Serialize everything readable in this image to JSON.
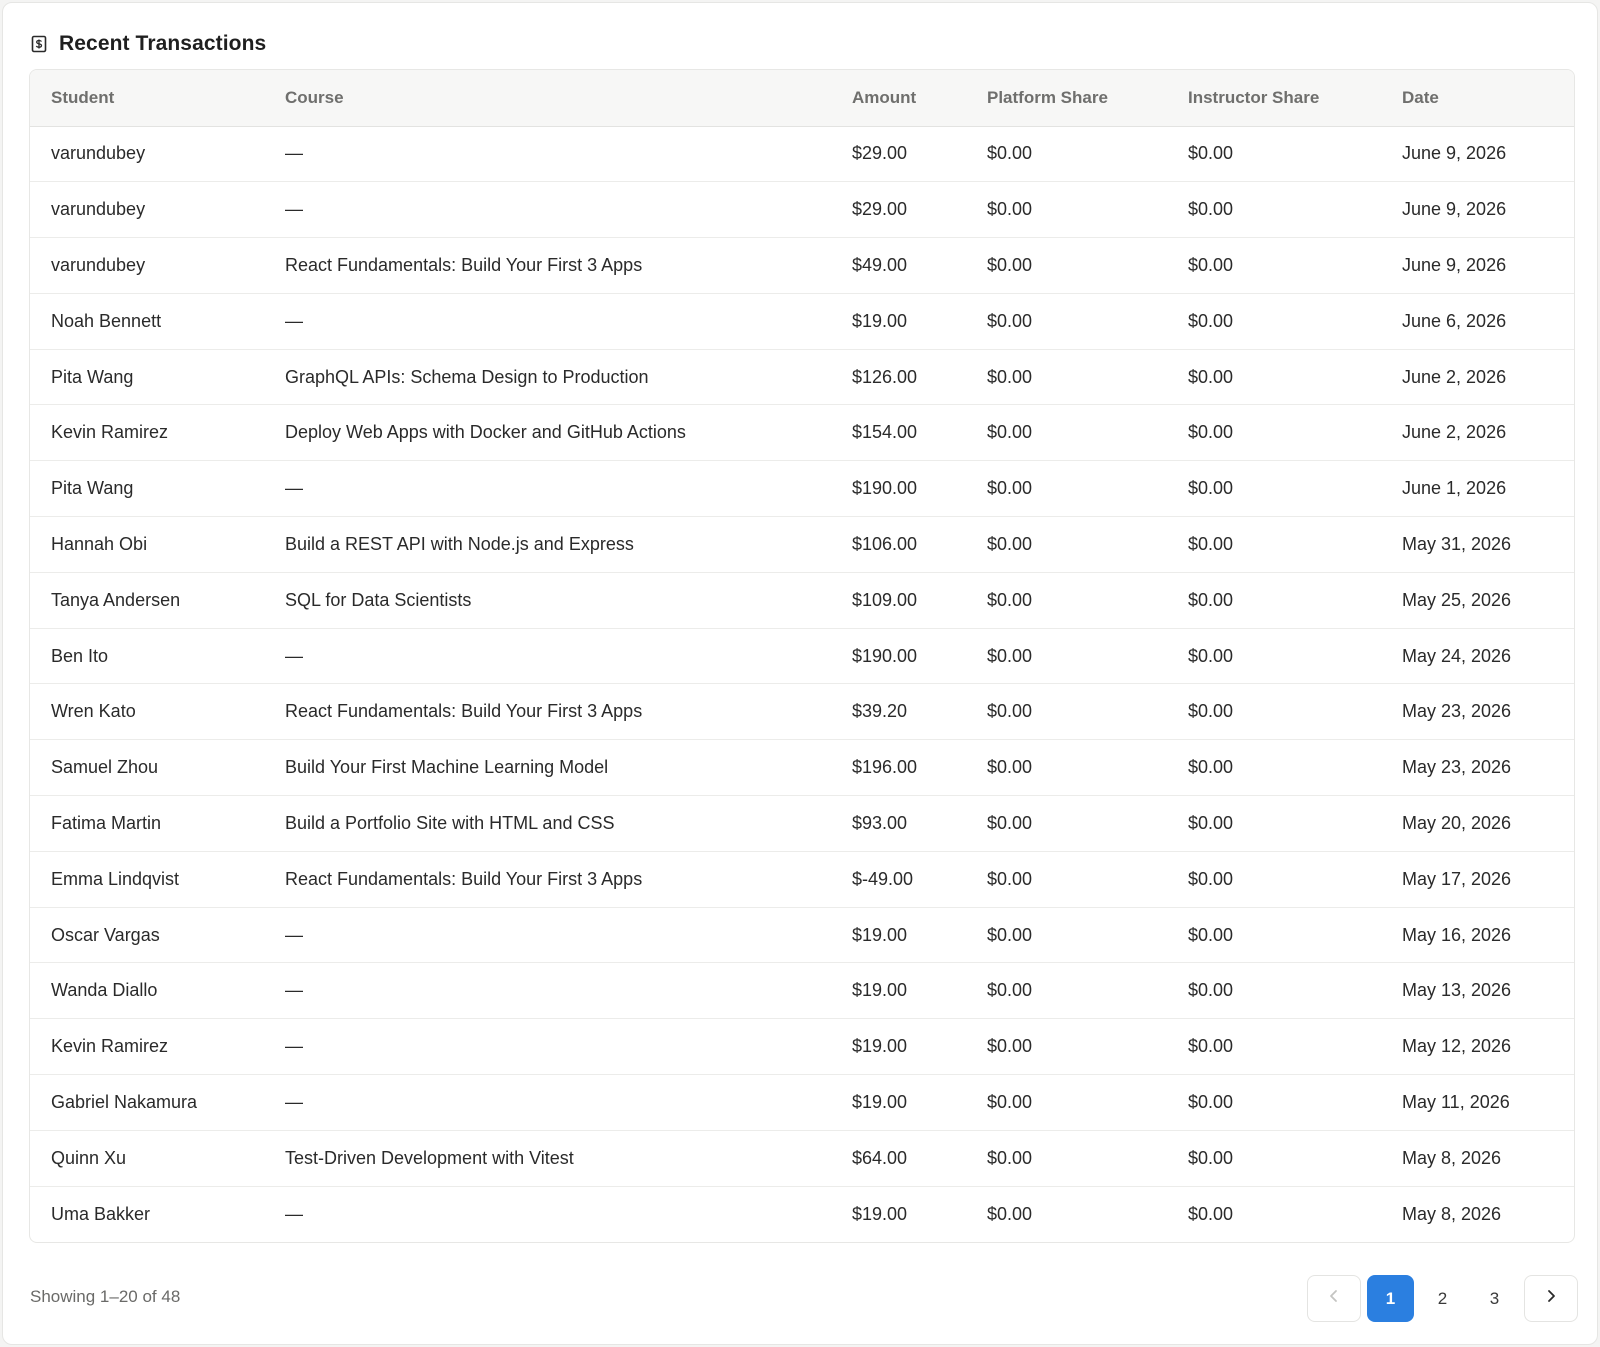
{
  "card": {
    "title": "Recent Transactions",
    "icon": "dollar-receipt-icon"
  },
  "table": {
    "headers": [
      "Student",
      "Course",
      "Amount",
      "Platform Share",
      "Instructor Share",
      "Date"
    ],
    "rows": [
      [
        "varundubey",
        "—",
        "$29.00",
        "$0.00",
        "$0.00",
        "June 9, 2026"
      ],
      [
        "varundubey",
        "—",
        "$29.00",
        "$0.00",
        "$0.00",
        "June 9, 2026"
      ],
      [
        "varundubey",
        "React Fundamentals: Build Your First 3 Apps",
        "$49.00",
        "$0.00",
        "$0.00",
        "June 9, 2026"
      ],
      [
        "Noah Bennett",
        "—",
        "$19.00",
        "$0.00",
        "$0.00",
        "June 6, 2026"
      ],
      [
        "Pita Wang",
        "GraphQL APIs: Schema Design to Production",
        "$126.00",
        "$0.00",
        "$0.00",
        "June 2, 2026"
      ],
      [
        "Kevin Ramirez",
        "Deploy Web Apps with Docker and GitHub Actions",
        "$154.00",
        "$0.00",
        "$0.00",
        "June 2, 2026"
      ],
      [
        "Pita Wang",
        "—",
        "$190.00",
        "$0.00",
        "$0.00",
        "June 1, 2026"
      ],
      [
        "Hannah Obi",
        "Build a REST API with Node.js and Express",
        "$106.00",
        "$0.00",
        "$0.00",
        "May 31, 2026"
      ],
      [
        "Tanya Andersen",
        "SQL for Data Scientists",
        "$109.00",
        "$0.00",
        "$0.00",
        "May 25, 2026"
      ],
      [
        "Ben Ito",
        "—",
        "$190.00",
        "$0.00",
        "$0.00",
        "May 24, 2026"
      ],
      [
        "Wren Kato",
        "React Fundamentals: Build Your First 3 Apps",
        "$39.20",
        "$0.00",
        "$0.00",
        "May 23, 2026"
      ],
      [
        "Samuel Zhou",
        "Build Your First Machine Learning Model",
        "$196.00",
        "$0.00",
        "$0.00",
        "May 23, 2026"
      ],
      [
        "Fatima Martin",
        "Build a Portfolio Site with HTML and CSS",
        "$93.00",
        "$0.00",
        "$0.00",
        "May 20, 2026"
      ],
      [
        "Emma Lindqvist",
        "React Fundamentals: Build Your First 3 Apps",
        "$-49.00",
        "$0.00",
        "$0.00",
        "May 17, 2026"
      ],
      [
        "Oscar Vargas",
        "—",
        "$19.00",
        "$0.00",
        "$0.00",
        "May 16, 2026"
      ],
      [
        "Wanda Diallo",
        "—",
        "$19.00",
        "$0.00",
        "$0.00",
        "May 13, 2026"
      ],
      [
        "Kevin Ramirez",
        "—",
        "$19.00",
        "$0.00",
        "$0.00",
        "May 12, 2026"
      ],
      [
        "Gabriel Nakamura",
        "—",
        "$19.00",
        "$0.00",
        "$0.00",
        "May 11, 2026"
      ],
      [
        "Quinn Xu",
        "Test-Driven Development with Vitest",
        "$64.00",
        "$0.00",
        "$0.00",
        "May 8, 2026"
      ],
      [
        "Uma Bakker",
        "—",
        "$19.00",
        "$0.00",
        "$0.00",
        "May 8, 2026"
      ]
    ]
  },
  "footer": {
    "showing_text": "Showing 1–20 of 48"
  },
  "pagination": {
    "prev_icon": "chevron-left-icon",
    "next_icon": "chevron-right-icon",
    "pages": [
      "1",
      "2",
      "3"
    ],
    "current_page": "1",
    "accent_color": "#2b7fe0"
  }
}
